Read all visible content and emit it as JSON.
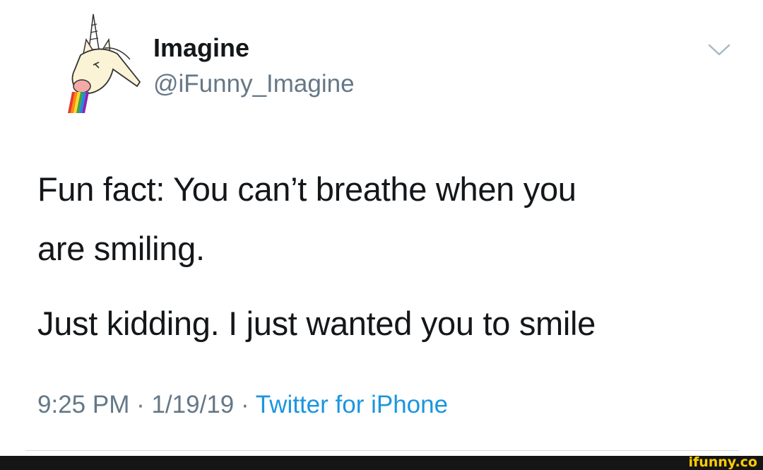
{
  "tweet": {
    "display_name": "Imagine",
    "handle": "@iFunny_Imagine",
    "text_lines": [
      "Fun fact: You can’t breathe when you",
      "are smiling.",
      "Just kidding. I just wanted you to smile"
    ],
    "time": "9:25 PM",
    "separator": " · ",
    "date": "1/19/19",
    "source": "Twitter for iPhone",
    "menu_icon": "chevron-down-icon",
    "avatar_icon": "unicorn-rainbow-avatar"
  },
  "watermark": {
    "text": "ifunny.co",
    "color": "#ffcc00"
  },
  "colors": {
    "primary_text": "#14171a",
    "secondary_text": "#657786",
    "link": "#1b95e0"
  }
}
